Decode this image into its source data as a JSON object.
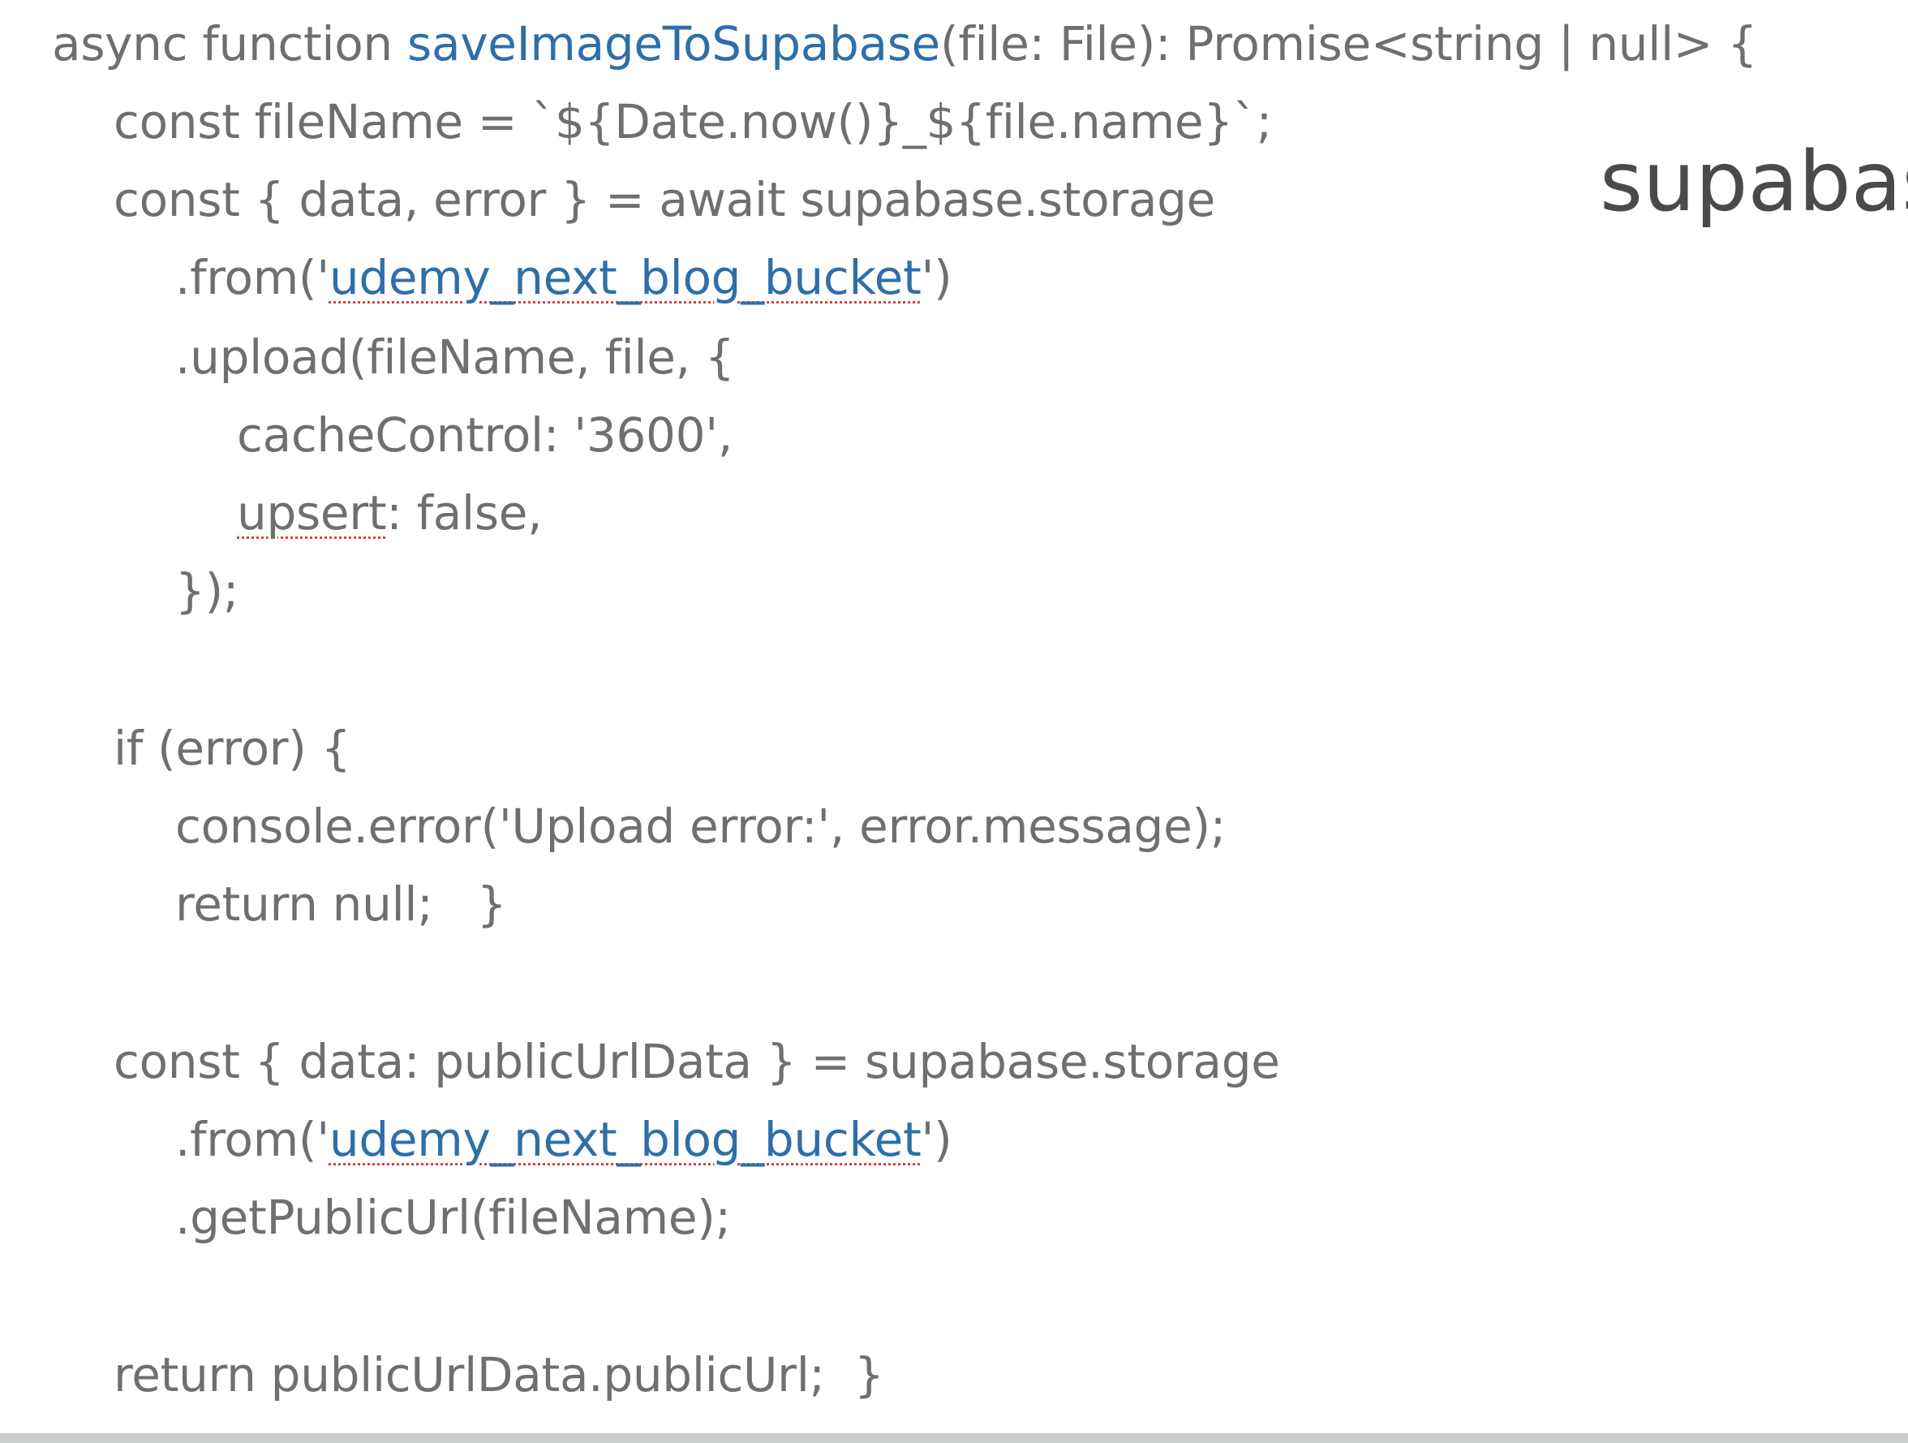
{
  "side_title": "supabase",
  "code": {
    "lines": [
      [
        {
          "text": "async function "
        },
        {
          "text": "saveImageToSupabase",
          "style": "fn"
        },
        {
          "text": "(file: File): Promise<string | null> {"
        }
      ],
      [
        {
          "text": "const fileName = `${Date.now()}_${file.name}`;"
        }
      ],
      [
        {
          "text": "const { data, error } = await supabase.storage"
        }
      ],
      [
        {
          "text": ".from('"
        },
        {
          "text": "udemy_next_blog_bucket",
          "style": "link"
        },
        {
          "text": "')"
        }
      ],
      [
        {
          "text": ".upload(fileName, file, {"
        }
      ],
      [
        {
          "text": "cacheControl: '3600',"
        }
      ],
      [
        {
          "text": "upsert",
          "style": "spell"
        },
        {
          "text": ": false,"
        }
      ],
      [
        {
          "text": "});"
        }
      ],
      [],
      [
        {
          "text": "if (error) {"
        }
      ],
      [
        {
          "text": "console.error('Upload error:', error.message);"
        }
      ],
      [
        {
          "text": "return null;   }"
        }
      ],
      [],
      [
        {
          "text": "const { data: publicUrlData } = supabase.storage"
        }
      ],
      [
        {
          "text": ".from('"
        },
        {
          "text": "udemy_next_blog_bucket",
          "style": "link"
        },
        {
          "text": "')"
        }
      ],
      [
        {
          "text": ".getPublicUrl(fileName);"
        }
      ],
      [],
      [
        {
          "text": "return publicUrlData.publicUrl;  }"
        }
      ]
    ]
  }
}
